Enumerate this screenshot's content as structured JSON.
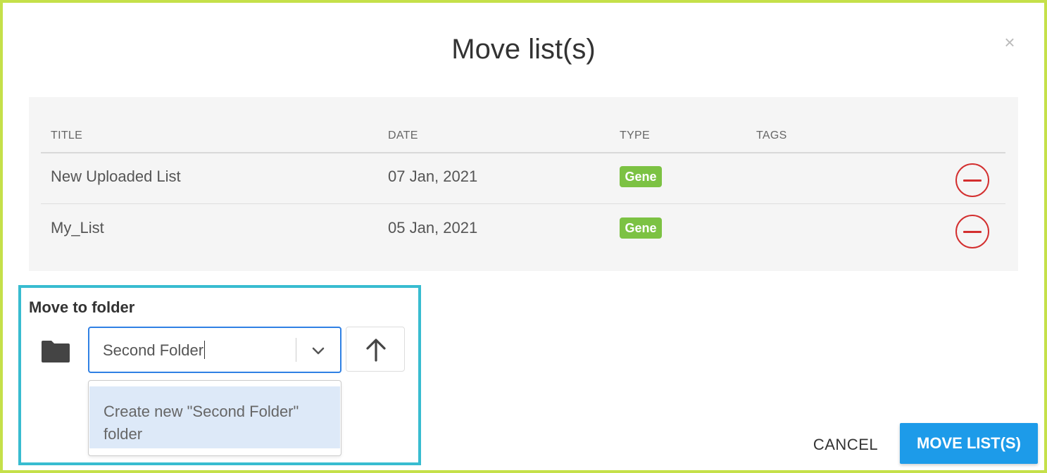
{
  "dialog": {
    "title": "Move list(s)",
    "close_glyph": "×",
    "close_icon": "close-icon"
  },
  "table": {
    "headers": {
      "title": "TITLE",
      "date": "DATE",
      "type": "TYPE",
      "tags": "TAGS"
    },
    "rows": [
      {
        "title": "New Uploaded List",
        "date": "07 Jan, 2021",
        "type": "Gene",
        "tags": "",
        "remove_icon": "minus-circle-icon"
      },
      {
        "title": "My_List",
        "date": "05 Jan, 2021",
        "type": "Gene",
        "tags": "",
        "remove_icon": "minus-circle-icon"
      }
    ]
  },
  "move_to_folder": {
    "label": "Move to folder",
    "folder_icon": "folder-icon",
    "select_value": "Second Folder",
    "dropdown_icon": "chevron-down-icon",
    "up_icon": "arrow-up-icon",
    "options": [
      {
        "label": "Create new \"Second Folder\" folder"
      }
    ]
  },
  "actions": {
    "cancel": "CANCEL",
    "submit": "MOVE LIST(S)"
  },
  "colors": {
    "accent": "#1d9be9",
    "badge": "#7cc243",
    "danger": "#d32f2f",
    "highlight_border": "#38bcd0",
    "outer_border": "#c5e04a"
  }
}
